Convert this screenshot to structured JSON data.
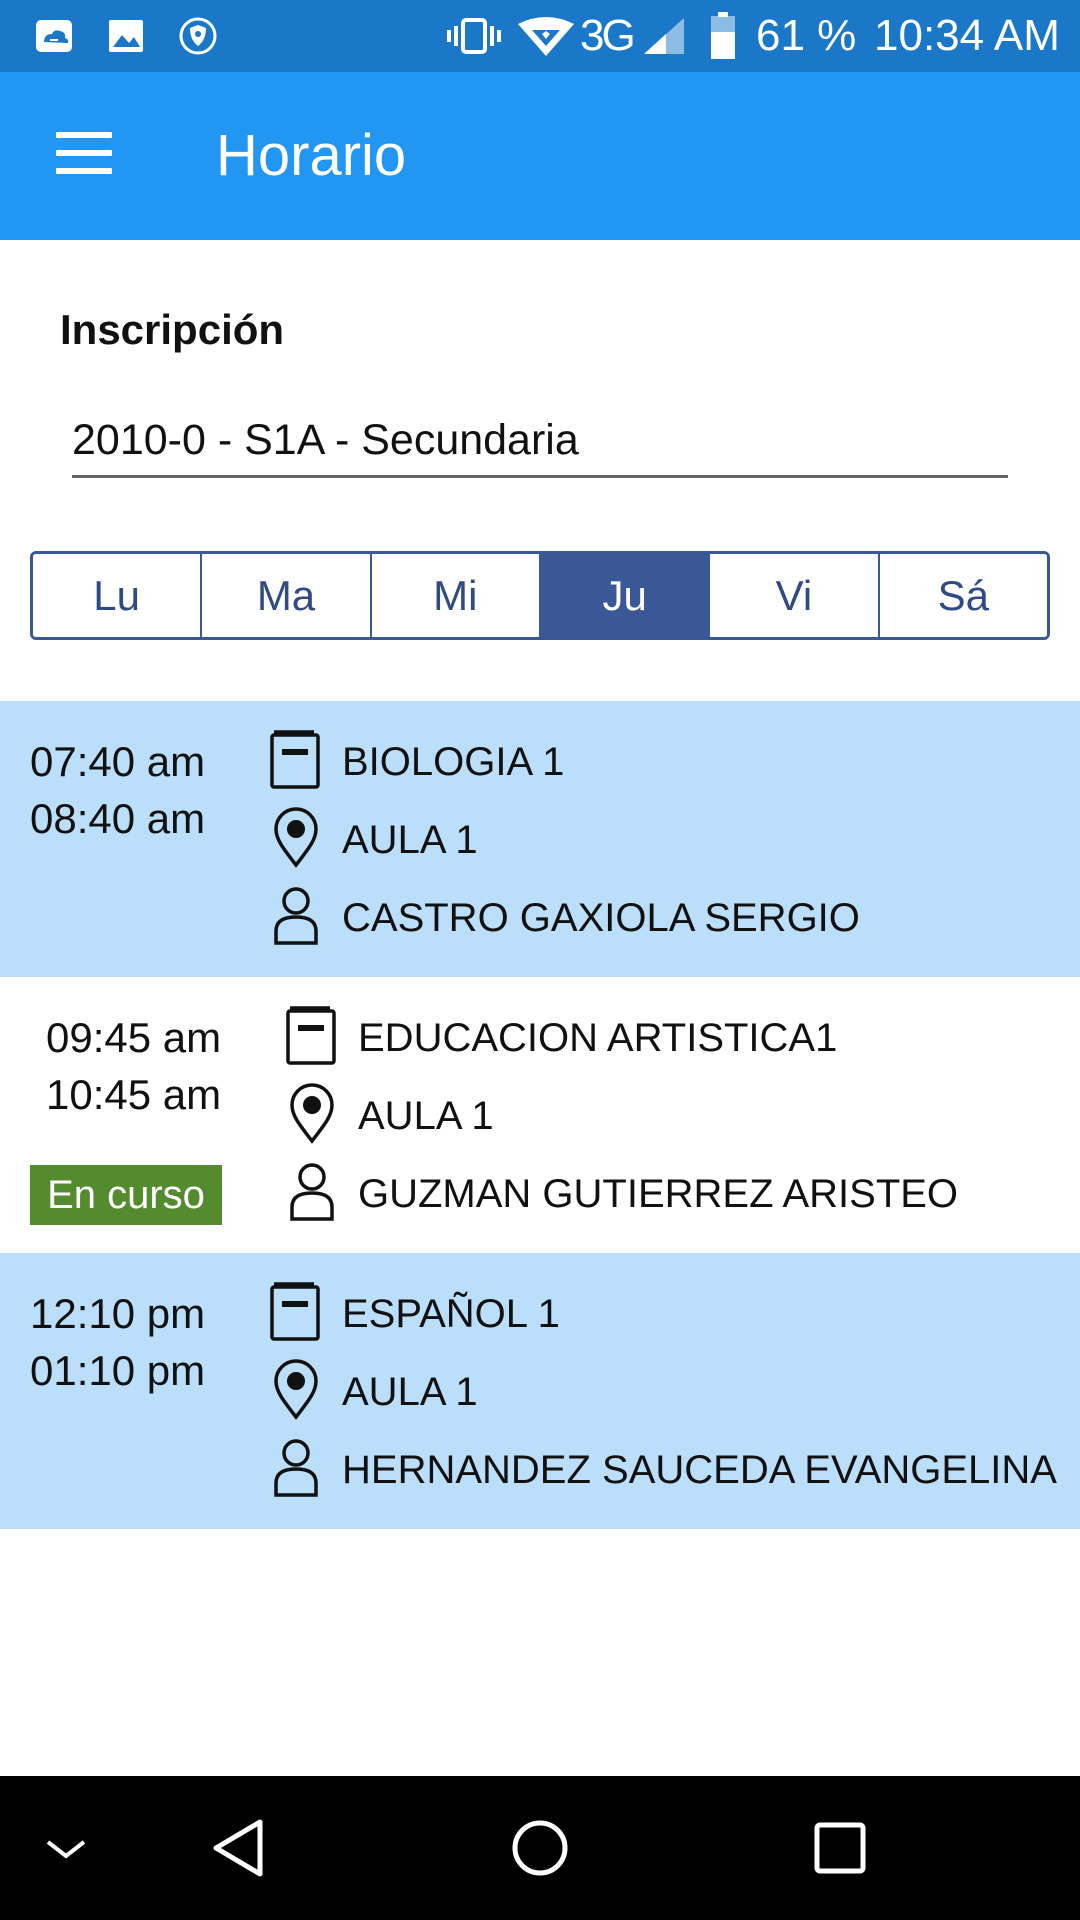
{
  "status_bar": {
    "network": "3G",
    "battery": "61 %",
    "time": "10:34 AM",
    "icons": [
      "cloud-app-icon",
      "image-icon",
      "shield-icon",
      "vibrate-icon",
      "wifi-icon",
      "signal-icon",
      "battery-icon"
    ]
  },
  "app_bar": {
    "title": "Horario",
    "menu_icon": "hamburger-menu-icon"
  },
  "enrollment": {
    "label": "Inscripción",
    "selected": "2010-0 - S1A - Secundaria"
  },
  "days": [
    {
      "label": "Lu",
      "active": false
    },
    {
      "label": "Ma",
      "active": false
    },
    {
      "label": "Mi",
      "active": false
    },
    {
      "label": "Ju",
      "active": true
    },
    {
      "label": "Vi",
      "active": false
    },
    {
      "label": "Sá",
      "active": false
    }
  ],
  "schedule": [
    {
      "start": "07:40 am",
      "end": "08:40 am",
      "subject": "BIOLOGIA 1",
      "room": "AULA 1",
      "teacher": "CASTRO GAXIOLA SERGIO",
      "status": ""
    },
    {
      "start": "09:45 am",
      "end": "10:45 am",
      "subject": "EDUCACION ARTISTICA1",
      "room": "AULA 1",
      "teacher": "GUZMAN GUTIERREZ ARISTEO",
      "status": "En curso"
    },
    {
      "start": "12:10 pm",
      "end": "01:10 pm",
      "subject": "ESPAÑOL 1",
      "room": "AULA 1",
      "teacher": "HERNANDEZ SAUCEDA EVANGELINA",
      "status": ""
    }
  ],
  "colors": {
    "app_bar": "#2196f3",
    "status_bar": "#1b78c9",
    "row_shaded": "#bbdefb",
    "tab_active": "#3b5896",
    "badge": "#558b2f"
  },
  "nav_bar": {
    "icons": [
      "chevron-down-icon",
      "back-icon",
      "home-icon",
      "recents-icon"
    ]
  }
}
